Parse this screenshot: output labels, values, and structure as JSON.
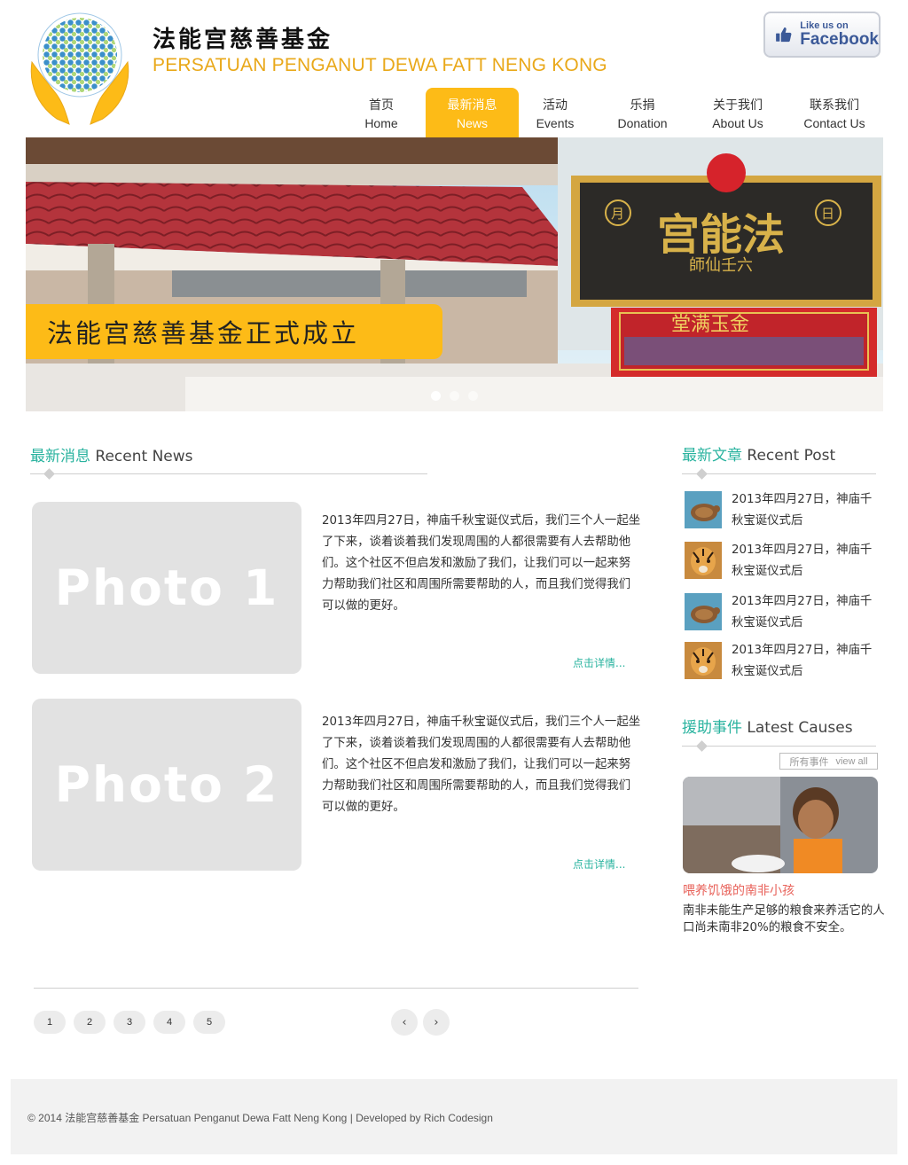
{
  "header": {
    "title_cn": "法能宫慈善基金",
    "title_en": "PERSATUAN PENGANUT DEWA FATT NENG KONG",
    "facebook": {
      "small": "Like us on",
      "big": "Facebook"
    }
  },
  "nav": [
    {
      "cn": "首页",
      "en": "Home"
    },
    {
      "cn": "最新消息",
      "en": "News",
      "active": true
    },
    {
      "cn": "活动",
      "en": "Events"
    },
    {
      "cn": "乐捐",
      "en": "Donation"
    },
    {
      "cn": "关于我们",
      "en": "About Us"
    },
    {
      "cn": "联系我们",
      "en": "Contact Us"
    }
  ],
  "hero": {
    "caption": "法能宫慈善基金正式成立",
    "sign_main": "宫能法",
    "sign_sub": "師仙壬六",
    "sign_left": "月",
    "sign_right": "日",
    "banner_text": "堂满玉金",
    "slides": 3,
    "active_slide": 1
  },
  "recent_news": {
    "heading_cn": "最新消息",
    "heading_en": "Recent News",
    "items": [
      {
        "photo": "Photo 1",
        "text": "2013年四月27日，神庙千秋宝诞仪式后，我们三个人一起坐了下来，谈着谈着我们发现周围的人都很需要有人去帮助他们。这个社区不但启发和激励了我们，让我们可以一起来努力帮助我们社区和周围所需要帮助的人，而且我们觉得我们可以做的更好。",
        "more": "点击详情..."
      },
      {
        "photo": "Photo 2",
        "text": "2013年四月27日，神庙千秋宝诞仪式后，我们三个人一起坐了下来，谈着谈着我们发现周围的人都很需要有人去帮助他们。这个社区不但启发和激励了我们，让我们可以一起来努力帮助我们社区和周围所需要帮助的人，而且我们觉得我们可以做的更好。",
        "more": "点击详情..."
      }
    ]
  },
  "pagination": {
    "pages": [
      "1",
      "2",
      "3",
      "4",
      "5"
    ],
    "prev": "‹",
    "next": "›"
  },
  "recent_post": {
    "heading_cn": "最新文章",
    "heading_en": "Recent Post",
    "items": [
      {
        "text": "2013年四月27日，神庙千秋宝诞仪式后",
        "thumb": "turtle"
      },
      {
        "text": "2013年四月27日，神庙千秋宝诞仪式后",
        "thumb": "tiger"
      },
      {
        "text": "2013年四月27日，神庙千秋宝诞仪式后",
        "thumb": "turtle"
      },
      {
        "text": "2013年四月27日，神庙千秋宝诞仪式后",
        "thumb": "tiger"
      }
    ]
  },
  "latest_causes": {
    "heading_cn": "援助事件",
    "heading_en": "Latest Causes",
    "view_all_cn": "所有事件",
    "view_all_en": "view all",
    "title": "喂养饥饿的南非小孩",
    "desc": "南非未能生产足够的粮食来养活它的人口尚未南非20%的粮食不安全。"
  },
  "footer": {
    "text": "© 2014 法能宫慈善基金  Persatuan Penganut Dewa Fatt Neng Kong  |   Developed by Rich Codesign"
  },
  "colors": {
    "accent_yellow": "#fdbb17",
    "accent_teal": "#2ab39f",
    "cause_red": "#e8625a"
  }
}
